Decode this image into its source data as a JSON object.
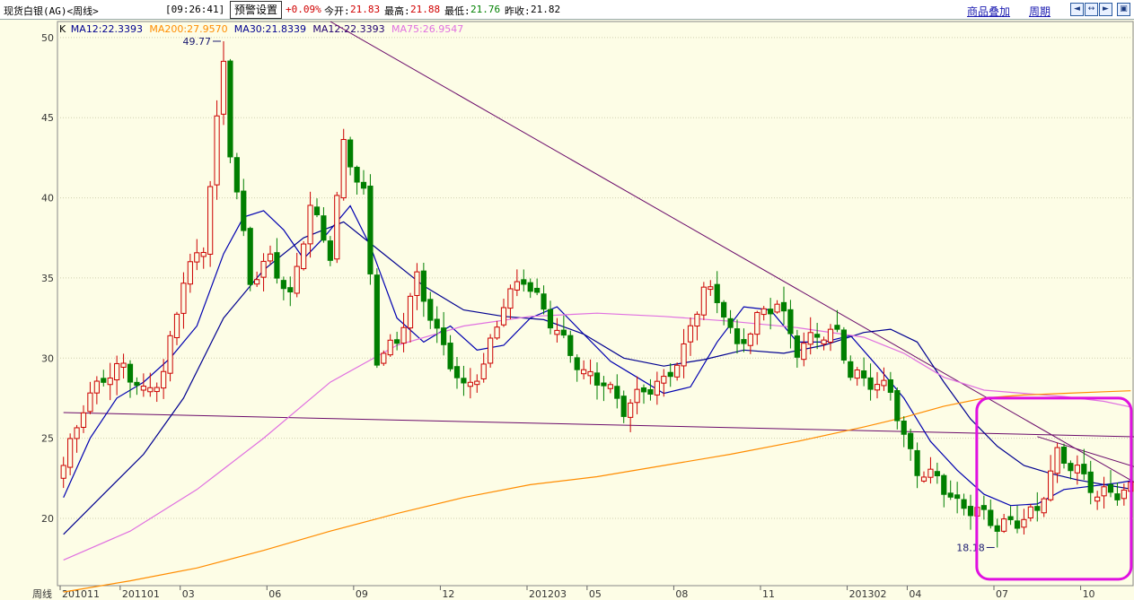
{
  "header": {
    "instrument": "现货白银(AG)<周线>",
    "time": "[09:26:41]",
    "alert_button": "预警设置",
    "change_pct": "+0.09%",
    "open_label": "今开:",
    "open_value": "21.83",
    "high_label": "最高:",
    "high_value": "21.88",
    "low_label": "最低:",
    "low_value": "21.76",
    "prev_close_label": "昨收:",
    "prev_close_value": "21.82",
    "overlay_link": "商品叠加",
    "period_link": "周期"
  },
  "window_buttons": [
    {
      "icon": "arrow-left-icon",
      "glyph": "◄"
    },
    {
      "icon": "arrows-horizontal-icon",
      "glyph": "↔"
    },
    {
      "icon": "arrow-right-icon",
      "glyph": "►"
    },
    {
      "icon": "window-restore-icon",
      "glyph": "▣"
    }
  ],
  "chart_data": {
    "type": "candlestick",
    "legend": [
      {
        "text": "K",
        "color": "#000000"
      },
      {
        "text": "MA12:22.3393",
        "color": "#000090"
      },
      {
        "text": "MA200:27.9570",
        "color": "#ff8c00"
      },
      {
        "text": "MA30:21.8339",
        "color": "#000090"
      },
      {
        "text": "MA12:22.3393",
        "color": "#200070"
      },
      {
        "text": "MA75:26.9547",
        "color": "#e070e0"
      }
    ],
    "ylim": [
      15.8,
      51
    ],
    "yticks": [
      20,
      25,
      30,
      35,
      40,
      45,
      50
    ],
    "xlabel": "周线",
    "xticks": [
      {
        "label": "201011",
        "i": 0
      },
      {
        "label": "201101",
        "i": 9
      },
      {
        "label": "03",
        "i": 18
      },
      {
        "label": "06",
        "i": 31
      },
      {
        "label": "09",
        "i": 44
      },
      {
        "label": "12",
        "i": 57
      },
      {
        "label": "201203",
        "i": 70
      },
      {
        "label": "05",
        "i": 79
      },
      {
        "label": "08",
        "i": 92
      },
      {
        "label": "11",
        "i": 105
      },
      {
        "label": "201302",
        "i": 118
      },
      {
        "label": "04",
        "i": 127
      },
      {
        "label": "07",
        "i": 140
      },
      {
        "label": "10",
        "i": 153
      }
    ],
    "annotations": [
      {
        "text": "49.77",
        "i": 24,
        "value": 49.77
      },
      {
        "text": "18.18",
        "i": 140,
        "value": 18.18
      }
    ],
    "trendlines": [
      {
        "p1": [
          0,
          26.6
        ],
        "p2": [
          170,
          25.0
        ]
      },
      {
        "p1": [
          40,
          51.0
        ],
        "p2": [
          170,
          20.0
        ]
      },
      {
        "p1": [
          146,
          25.1
        ],
        "p2": [
          170,
          22.0
        ]
      }
    ],
    "ohlc_anchors": [
      [
        0,
        23.3
      ],
      [
        3,
        27.0
      ],
      [
        6,
        28.8
      ],
      [
        9,
        29.5
      ],
      [
        12,
        27.8
      ],
      [
        15,
        29.0
      ],
      [
        18,
        35.0
      ],
      [
        21,
        37.0
      ],
      [
        24,
        48.5
      ],
      [
        25,
        43.0
      ],
      [
        28,
        34.8
      ],
      [
        31,
        36.2
      ],
      [
        34,
        33.7
      ],
      [
        37,
        39.5
      ],
      [
        40,
        36.5
      ],
      [
        42,
        43.3
      ],
      [
        45,
        40.2
      ],
      [
        47,
        30.0
      ],
      [
        50,
        31.0
      ],
      [
        53,
        35.0
      ],
      [
        56,
        31.5
      ],
      [
        60,
        28.0
      ],
      [
        63,
        29.5
      ],
      [
        66,
        33.5
      ],
      [
        69,
        35.0
      ],
      [
        72,
        33.0
      ],
      [
        75,
        31.0
      ],
      [
        78,
        29.0
      ],
      [
        81,
        28.5
      ],
      [
        84,
        26.8
      ],
      [
        87,
        28.0
      ],
      [
        90,
        28.5
      ],
      [
        93,
        30.5
      ],
      [
        96,
        34.5
      ],
      [
        99,
        33.0
      ],
      [
        101,
        30.5
      ],
      [
        104,
        32.5
      ],
      [
        107,
        33.5
      ],
      [
        110,
        30.5
      ],
      [
        113,
        31.5
      ],
      [
        116,
        31.5
      ],
      [
        118,
        29.0
      ],
      [
        121,
        28.5
      ],
      [
        124,
        28.0
      ],
      [
        126,
        25.0
      ],
      [
        128,
        23.0
      ],
      [
        131,
        22.5
      ],
      [
        134,
        20.8
      ],
      [
        137,
        20.5
      ],
      [
        140,
        19.5
      ],
      [
        143,
        19.8
      ],
      [
        146,
        20.5
      ],
      [
        149,
        24.0
      ],
      [
        152,
        23.0
      ],
      [
        155,
        21.5
      ],
      [
        158,
        21.6
      ],
      [
        160,
        21.82
      ]
    ],
    "ma_lines": [
      {
        "name": "MA12",
        "color": "#0000b0",
        "points": [
          [
            0,
            21.3
          ],
          [
            4,
            25.0
          ],
          [
            8,
            27.5
          ],
          [
            12,
            28.5
          ],
          [
            16,
            30.0
          ],
          [
            20,
            32.0
          ],
          [
            24,
            36.5
          ],
          [
            27,
            38.8
          ],
          [
            30,
            39.2
          ],
          [
            33,
            38.0
          ],
          [
            36,
            36.2
          ],
          [
            39,
            37.5
          ],
          [
            43,
            39.5
          ],
          [
            46,
            37.0
          ],
          [
            50,
            32.5
          ],
          [
            54,
            31.0
          ],
          [
            58,
            32.0
          ],
          [
            62,
            30.5
          ],
          [
            66,
            30.8
          ],
          [
            70,
            32.5
          ],
          [
            74,
            33.2
          ],
          [
            78,
            31.5
          ],
          [
            82,
            29.8
          ],
          [
            86,
            28.8
          ],
          [
            90,
            27.8
          ],
          [
            94,
            28.2
          ],
          [
            98,
            31.0
          ],
          [
            102,
            33.2
          ],
          [
            106,
            33.0
          ],
          [
            110,
            31.0
          ],
          [
            114,
            31.0
          ],
          [
            118,
            31.4
          ],
          [
            122,
            29.5
          ],
          [
            126,
            27.5
          ],
          [
            130,
            24.8
          ],
          [
            134,
            23.0
          ],
          [
            138,
            21.5
          ],
          [
            142,
            20.8
          ],
          [
            146,
            20.9
          ],
          [
            150,
            21.8
          ],
          [
            154,
            22.0
          ],
          [
            158,
            22.2
          ],
          [
            160,
            22.34
          ]
        ]
      },
      {
        "name": "MA30",
        "color": "#000090",
        "points": [
          [
            0,
            19.0
          ],
          [
            6,
            21.5
          ],
          [
            12,
            24.0
          ],
          [
            18,
            27.5
          ],
          [
            24,
            32.5
          ],
          [
            30,
            35.5
          ],
          [
            36,
            37.5
          ],
          [
            42,
            38.5
          ],
          [
            48,
            36.5
          ],
          [
            54,
            34.5
          ],
          [
            60,
            33.0
          ],
          [
            66,
            32.6
          ],
          [
            72,
            32.4
          ],
          [
            78,
            31.5
          ],
          [
            84,
            30.0
          ],
          [
            90,
            29.5
          ],
          [
            96,
            29.9
          ],
          [
            102,
            30.5
          ],
          [
            108,
            30.3
          ],
          [
            114,
            30.8
          ],
          [
            120,
            31.6
          ],
          [
            124,
            31.8
          ],
          [
            128,
            31.0
          ],
          [
            132,
            28.5
          ],
          [
            136,
            26.2
          ],
          [
            140,
            24.5
          ],
          [
            144,
            23.3
          ],
          [
            148,
            22.8
          ],
          [
            152,
            22.4
          ],
          [
            156,
            22.1
          ],
          [
            160,
            21.83
          ]
        ]
      },
      {
        "name": "MA75",
        "color": "#e070e0",
        "points": [
          [
            0,
            17.4
          ],
          [
            10,
            19.2
          ],
          [
            20,
            21.8
          ],
          [
            30,
            25.0
          ],
          [
            40,
            28.5
          ],
          [
            50,
            30.8
          ],
          [
            60,
            32.0
          ],
          [
            70,
            32.6
          ],
          [
            80,
            32.8
          ],
          [
            90,
            32.6
          ],
          [
            100,
            32.3
          ],
          [
            110,
            31.9
          ],
          [
            120,
            31.3
          ],
          [
            126,
            30.3
          ],
          [
            132,
            28.8
          ],
          [
            138,
            28.0
          ],
          [
            144,
            27.8
          ],
          [
            150,
            27.6
          ],
          [
            156,
            27.3
          ],
          [
            160,
            26.95
          ]
        ]
      },
      {
        "name": "MA200",
        "color": "#ff8c00",
        "points": [
          [
            0,
            15.4
          ],
          [
            10,
            16.1
          ],
          [
            20,
            16.9
          ],
          [
            30,
            18.0
          ],
          [
            40,
            19.2
          ],
          [
            50,
            20.3
          ],
          [
            60,
            21.3
          ],
          [
            70,
            22.1
          ],
          [
            80,
            22.6
          ],
          [
            90,
            23.3
          ],
          [
            100,
            24.0
          ],
          [
            110,
            24.8
          ],
          [
            120,
            25.7
          ],
          [
            126,
            26.3
          ],
          [
            132,
            27.0
          ],
          [
            138,
            27.5
          ],
          [
            144,
            27.7
          ],
          [
            150,
            27.8
          ],
          [
            156,
            27.9
          ],
          [
            160,
            27.96
          ]
        ]
      }
    ],
    "highlight": {
      "i_from": 138,
      "i_to": 159,
      "top": 27.5,
      "bottom": 16.2,
      "color": "#e010e0"
    },
    "grid": true
  }
}
